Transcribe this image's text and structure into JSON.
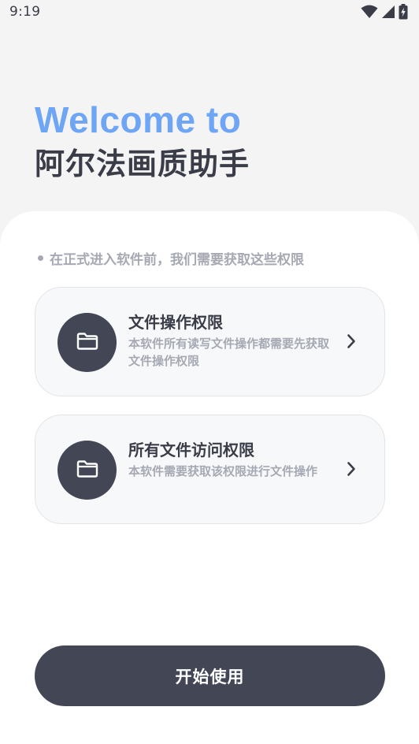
{
  "status_bar": {
    "time": "9:19",
    "icons": [
      "wifi-icon",
      "cell-signal-icon",
      "battery-charging-icon"
    ]
  },
  "hero": {
    "welcome": "Welcome to",
    "app_name": "阿尔法画质助手"
  },
  "hint": "在正式进入软件前，我们需要获取这些权限",
  "permissions": [
    {
      "icon": "folder-icon",
      "title": "文件操作权限",
      "description": "本软件所有读写文件操作都需要先获取文件操作权限"
    },
    {
      "icon": "folder-icon",
      "title": "所有文件访问权限",
      "description": "本软件需要获取该权限进行文件操作"
    }
  ],
  "start_button": "开始使用",
  "colors": {
    "accent_blue": "#6ea5f4",
    "dark": "#434755",
    "text_dark": "#3a3d48",
    "text_muted": "#a6a9b3",
    "background": "#f4f4f5"
  }
}
